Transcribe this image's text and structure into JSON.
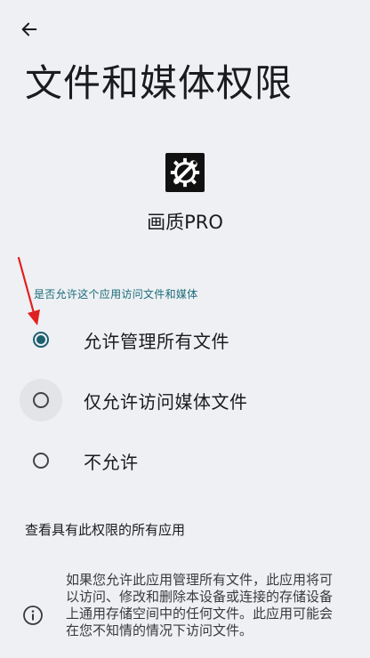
{
  "header": {
    "back_label": "返回",
    "title": "文件和媒体权限"
  },
  "app": {
    "icon": "gear-wrench-icon",
    "name": "画质PRO"
  },
  "permission": {
    "section_label": "是否允许这个应用访问文件和媒体",
    "options": [
      {
        "label": "允许管理所有文件",
        "selected": true
      },
      {
        "label": "仅允许访问媒体文件",
        "selected": false
      },
      {
        "label": "不允许",
        "selected": false
      }
    ]
  },
  "links": {
    "view_all": "查看具有此权限的所有应用"
  },
  "info": {
    "icon": "info-icon",
    "text": "如果您允许此应用管理所有文件，此应用将可以访问、修改和删除本设备或连接的存储设备上通用存储空间中的任何文件。此应用可能会在您不知情的情况下访问文件。"
  },
  "colors": {
    "accent": "#1b5f6f",
    "section_label": "#1b6c7a",
    "background": "#eef0f3",
    "annotation_arrow": "#e02020"
  }
}
